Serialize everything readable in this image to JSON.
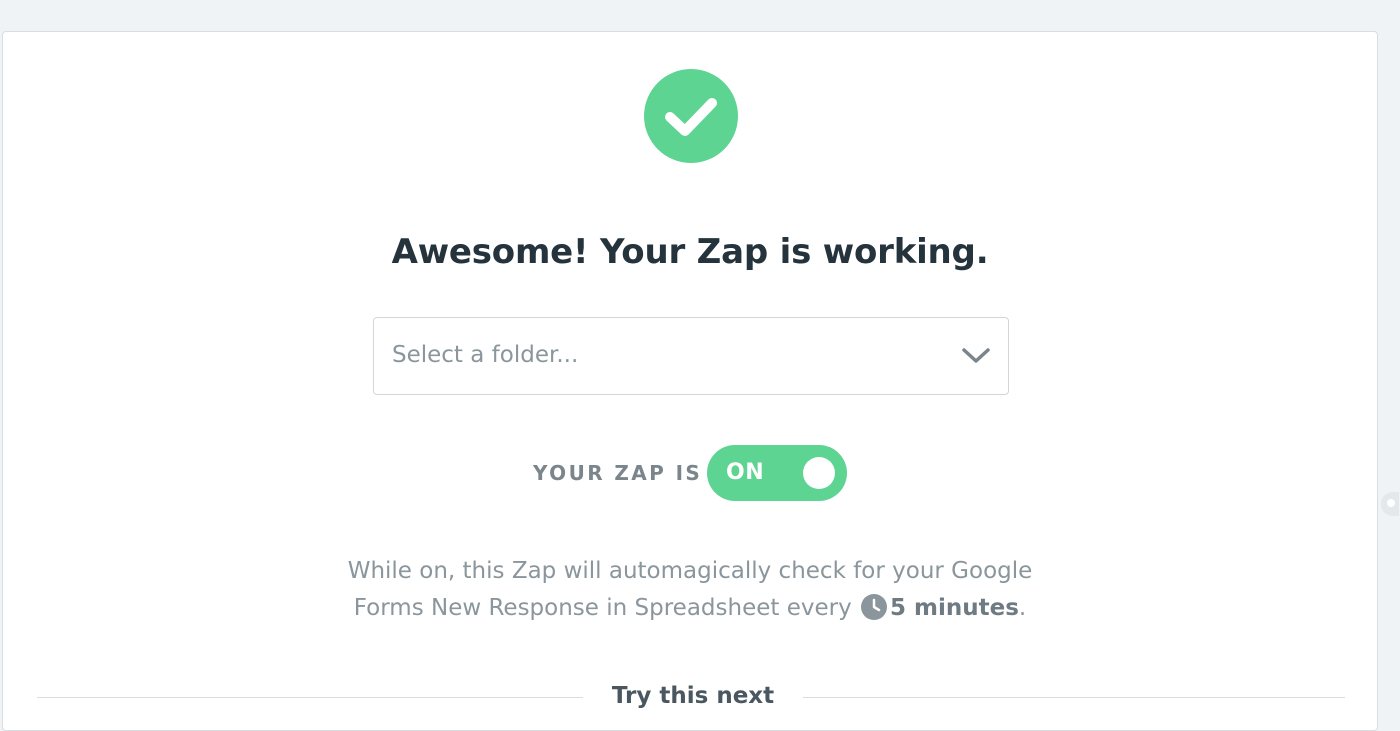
{
  "success": {
    "icon": "check-icon",
    "title": "Awesome! Your Zap is working."
  },
  "folder": {
    "placeholder": "Select a folder...",
    "icon": "chevron-down-icon"
  },
  "status": {
    "label": "YOUR ZAP IS",
    "toggle_text": "ON",
    "is_on": true
  },
  "description": {
    "line1": "While on, this Zap will automagically check for your Google",
    "line2_prefix": "Forms New Response in Spreadsheet every",
    "clock_icon": "clock-icon",
    "interval": "5 minutes",
    "suffix": "."
  },
  "next": {
    "label": "Try this next"
  },
  "colors": {
    "accent": "#5ed492",
    "heading": "#25333d",
    "muted": "#8a969c",
    "background": "#eff3f5"
  }
}
